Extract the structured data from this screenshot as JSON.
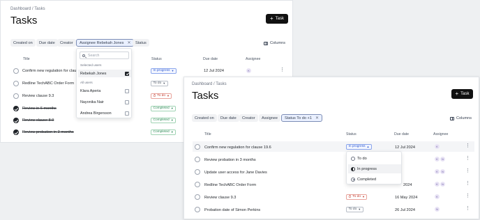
{
  "back_window": {
    "breadcrumb": {
      "root": "Dashboard",
      "sep": "/",
      "current": "Tasks"
    },
    "page_title": "Tasks",
    "new_task_label": "Task",
    "filters": {
      "created_on": "Created on",
      "due_date": "Due date",
      "creator": "Creator",
      "assignee_active": "Assignee Rebekah Jones",
      "status": "Status",
      "columns": "Columns"
    },
    "columns": {
      "title": "Title",
      "status": "Status",
      "due": "Due date",
      "assignee": "Assignee"
    },
    "rows": [
      {
        "title": "Confirm new regulation for clause",
        "status": "In progress",
        "due": "12 Jul 2024",
        "assignee": "K",
        "done": false
      },
      {
        "title": "Redline TechABC Order Form",
        "status": "To do",
        "due": "",
        "assignee": "",
        "done": false
      },
      {
        "title": "Review clause 9.3",
        "status": "To do",
        "due": "",
        "assignee": "",
        "done": false
      },
      {
        "title": "Review in 6 months",
        "status": "Completed",
        "due": "",
        "assignee": "",
        "done": true
      },
      {
        "title": "Review clause 8.9",
        "status": "Completed",
        "due": "",
        "assignee": "",
        "done": true
      },
      {
        "title": "Review probation in 3 months",
        "status": "Completed",
        "due": "",
        "assignee": "",
        "done": true
      }
    ],
    "assignee_dropdown": {
      "search_placeholder": "Search",
      "selected_header": "Selected users",
      "selected": [
        {
          "name": "Rebekah Jones",
          "checked": true
        }
      ],
      "all_header": "All users",
      "all": [
        {
          "name": "Klara Aperia",
          "checked": false
        },
        {
          "name": "Nayonika Nair",
          "checked": false
        },
        {
          "name": "Andrea Birgersson",
          "checked": false
        }
      ]
    }
  },
  "front_window": {
    "breadcrumb": {
      "root": "Dashboard",
      "sep": "/",
      "current": "Tasks"
    },
    "page_title": "Tasks",
    "new_task_label": "Task",
    "filters": {
      "created_on": "Created on",
      "due_date": "Due date",
      "creator": "Creator",
      "assignee": "Assignee",
      "status_active": "Status To do +1",
      "columns": "Columns"
    },
    "columns": {
      "title": "Title",
      "status": "Status",
      "due": "Due date",
      "assignee": "Assignee"
    },
    "rows": [
      {
        "title": "Confirm new regulation for clause 19.6",
        "status": "In progress",
        "due": "12 Jul 2024",
        "assignees": [
          "K"
        ]
      },
      {
        "title": "Review probation in 3 months",
        "status": "",
        "due": "",
        "assignees": [
          "K",
          "N"
        ]
      },
      {
        "title": "Update user access for Jane Davies",
        "status": "",
        "due": "",
        "assignees": [
          "K",
          "N"
        ]
      },
      {
        "title": "Redline TechABC Order Form",
        "status": "",
        "due": "2024",
        "assignees": [
          "K",
          "N"
        ]
      },
      {
        "title": "Review clause 9.3",
        "status": "To do",
        "due": "16 May 2024",
        "assignees": [
          "K"
        ]
      },
      {
        "title": "Probation date of Simon Perkins",
        "status": "To do",
        "due": "26 Jul 2024",
        "assignees": [
          "N"
        ]
      }
    ],
    "status_dropdown": {
      "options": [
        {
          "label": "To do",
          "icon": "circle-empty-icon"
        },
        {
          "label": "In progress",
          "icon": "circle-half-icon"
        },
        {
          "label": "Completed",
          "icon": "circle-check-icon"
        }
      ]
    }
  },
  "colors": {
    "accent": "#2f5bd3",
    "overdue": "#c0392b",
    "completed": "#2e8b57",
    "primary_button": "#111111"
  }
}
